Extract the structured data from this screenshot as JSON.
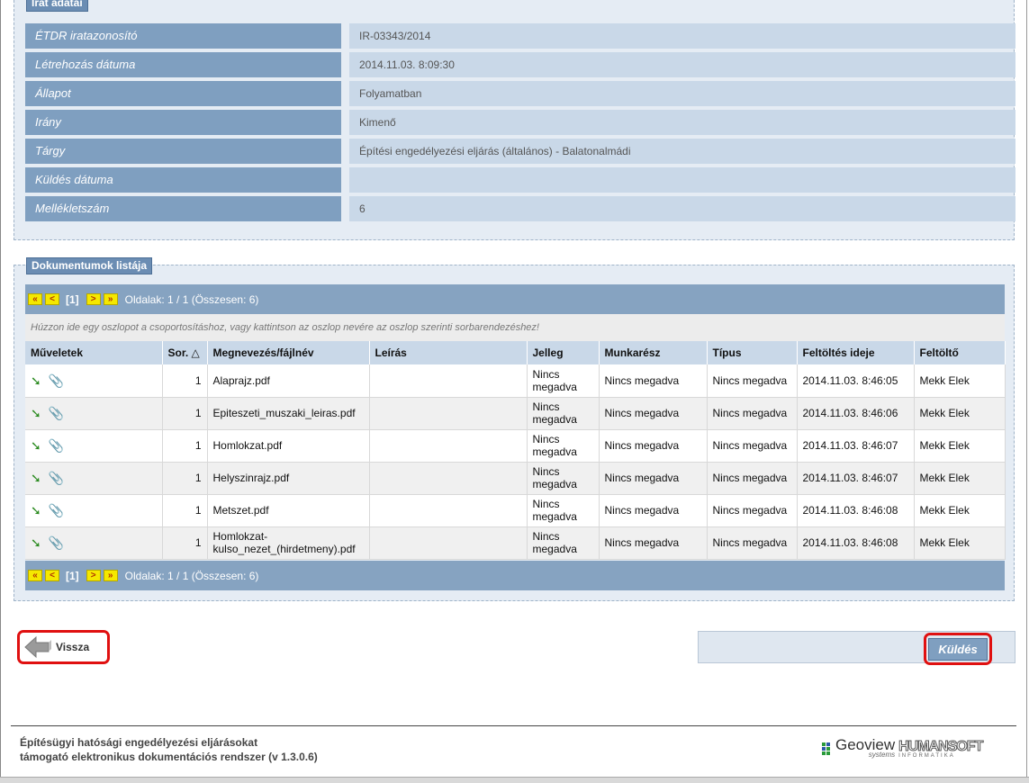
{
  "irat": {
    "legend": "Irat adatai",
    "rows": [
      {
        "label": "ÉTDR iratazonosító",
        "value": "IR-03343/2014"
      },
      {
        "label": "Létrehozás dátuma",
        "value": "2014.11.03. 8:09:30"
      },
      {
        "label": "Állapot",
        "value": "Folyamatban"
      },
      {
        "label": "Irány",
        "value": "Kimenő"
      },
      {
        "label": "Tárgy",
        "value": "Építési engedélyezési eljárás (általános) - Balatonalmádi"
      },
      {
        "label": "Küldés dátuma",
        "value": ""
      },
      {
        "label": "Mellékletszám",
        "value": "6"
      }
    ]
  },
  "docs": {
    "legend": "Dokumentumok listája",
    "pager": {
      "first": "«",
      "prev": "<",
      "current": "[1]",
      "next": ">",
      "last": "»",
      "info": "Oldalak: 1 / 1 (Összesen: 6)"
    },
    "group_hint": "Húzzon ide egy oszlopot a csoportosításhoz, vagy kattintson az oszlop nevére az oszlop szerinti sorbarendezéshez!",
    "columns": [
      "Műveletek",
      "Sor. △",
      "Megnevezés/fájlnév",
      "Leírás",
      "Jelleg",
      "Munkarész",
      "Típus",
      "Feltöltés ideje",
      "Feltöltő"
    ],
    "rows": [
      {
        "sor": "1",
        "name": "Alaprajz.pdf",
        "desc": "",
        "jelleg": "Nincs megadva",
        "munkaresz": "Nincs megadva",
        "tipus": "Nincs megadva",
        "ido": "2014.11.03. 8:46:05",
        "feltolto": "Mekk Elek"
      },
      {
        "sor": "1",
        "name": "Epiteszeti_muszaki_leiras.pdf",
        "desc": "",
        "jelleg": "Nincs megadva",
        "munkaresz": "Nincs megadva",
        "tipus": "Nincs megadva",
        "ido": "2014.11.03. 8:46:06",
        "feltolto": "Mekk Elek"
      },
      {
        "sor": "1",
        "name": "Homlokzat.pdf",
        "desc": "",
        "jelleg": "Nincs megadva",
        "munkaresz": "Nincs megadva",
        "tipus": "Nincs megadva",
        "ido": "2014.11.03. 8:46:07",
        "feltolto": "Mekk Elek"
      },
      {
        "sor": "1",
        "name": "Helyszinrajz.pdf",
        "desc": "",
        "jelleg": "Nincs megadva",
        "munkaresz": "Nincs megadva",
        "tipus": "Nincs megadva",
        "ido": "2014.11.03. 8:46:07",
        "feltolto": "Mekk Elek"
      },
      {
        "sor": "1",
        "name": "Metszet.pdf",
        "desc": "",
        "jelleg": "Nincs megadva",
        "munkaresz": "Nincs megadva",
        "tipus": "Nincs megadva",
        "ido": "2014.11.03. 8:46:08",
        "feltolto": "Mekk Elek"
      },
      {
        "sor": "1",
        "name": "Homlokzat-kulso_nezet_(hirdetmeny).pdf",
        "desc": "",
        "jelleg": "Nincs megadva",
        "munkaresz": "Nincs megadva",
        "tipus": "Nincs megadva",
        "ido": "2014.11.03. 8:46:08",
        "feltolto": "Mekk Elek"
      }
    ],
    "row_icons": [
      "download-icon",
      "paperclip-icon"
    ]
  },
  "actions": {
    "back_label": "Vissza",
    "send_label": "Küldés"
  },
  "footer": {
    "line1": "Építésügyi hatósági engedélyezési eljárásokat",
    "line2": "támogató elektronikus dokumentációs rendszer (v 1.3.0.6)",
    "geoview": "Geoview",
    "geoview_sub": "systems",
    "humansoft": "HUMANSOFT",
    "humansoft_sub": "INFORMATIKA"
  },
  "colors": {
    "label_bg": "#7f9fc0",
    "value_bg": "#c9d8e8",
    "pager_bg": "#86a3c1",
    "highlight": "#e01010"
  }
}
